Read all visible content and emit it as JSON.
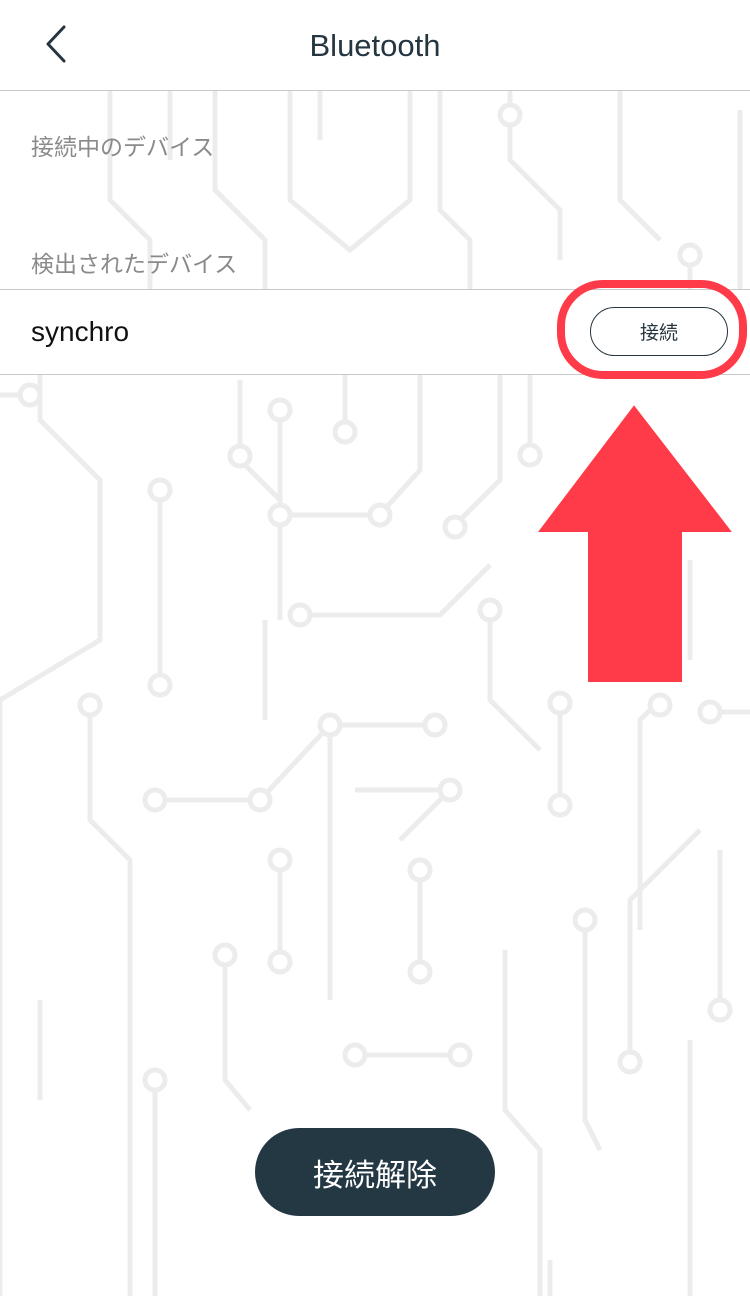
{
  "nav": {
    "title": "Bluetooth",
    "back_icon": "chevron-left-icon"
  },
  "sections": {
    "connected_header": "接続中のデバイス",
    "found_header": "検出されたデバイス"
  },
  "devices": [
    {
      "name": "synchro",
      "connect_label": "接続"
    }
  ],
  "footer": {
    "disconnect_label": "接続解除"
  },
  "colors": {
    "primary_dark": "#243844",
    "annotation_red": "#ff3a49",
    "divider": "#c9c9c9",
    "section_text": "#8a8a8a",
    "circuit_pattern": "#ececec"
  },
  "annotation": {
    "highlight_target": "connect-button",
    "arrow_icon": "arrow-up-icon"
  }
}
